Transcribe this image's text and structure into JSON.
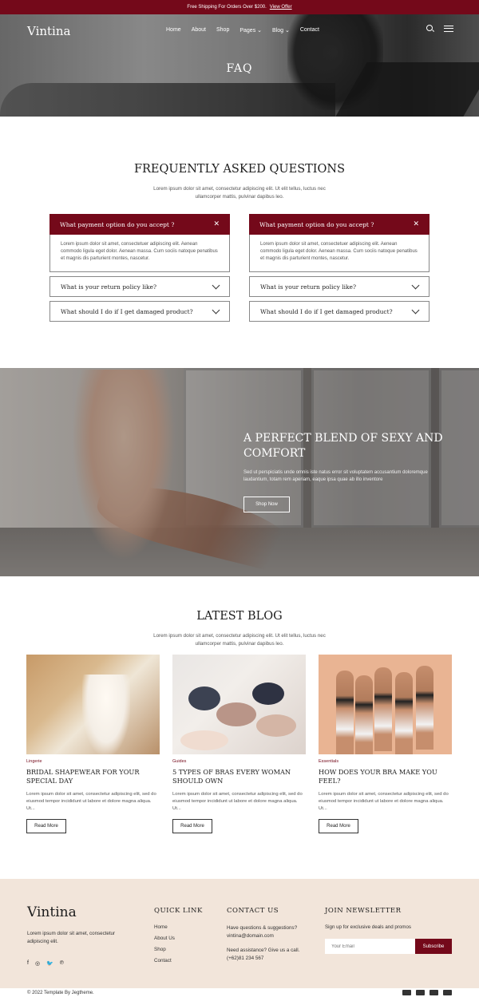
{
  "topbar": {
    "text": "Free Shipping For Orders Over $200.",
    "offer": "View Offer"
  },
  "header": {
    "logo": "Vintina",
    "nav": [
      "Home",
      "About",
      "Shop",
      "Pages",
      "Blog",
      "Contact"
    ],
    "hero_title": "FAQ"
  },
  "faq": {
    "title": "FREQUENTLY ASKED QUESTIONS",
    "subtitle": "Lorem ipsum dolor sit amet, consectetur adipiscing elit. Ut elit tellus, luctus nec ullamcorper mattis, pulvinar dapibus leo.",
    "columns": [
      {
        "open_question": "What payment option do you accept ?",
        "open_answer": "Lorem ipsum dolor sit amet, consectetuer adipiscing elit. Aenean commodo ligula eget dolor. Aenean massa. Cum sociis natoque penatibus et magnis dis parturient montes, nascetur.",
        "questions": [
          "What is your return policy like?",
          "What should I do if I get damaged product?"
        ]
      },
      {
        "open_question": "What payment option do you accept ?",
        "open_answer": "Lorem ipsum dolor sit amet, consectetuer adipiscing elit. Aenean commodo ligula eget dolor. Aenean massa. Cum sociis natoque penatibus et magnis dis parturient montes, nascetur.",
        "questions": [
          "What is your return policy like?",
          "What should I do if I get damaged product?"
        ]
      }
    ]
  },
  "banner": {
    "title": "A PERFECT BLEND OF SEXY AND COMFORT",
    "text": "Sed ut perspiciatis unde omnis iste natus error sit voluptatem accusantium doloremque laudantium, totam rem aperiam, eaque ipsa quae ab illo inventore",
    "button": "Shop Now"
  },
  "blog": {
    "title": "LATEST BLOG",
    "subtitle": "Lorem ipsum dolor sit amet, consectetur adipiscing elit. Ut elit tellus, luctus nec ullamcorper mattis, pulvinar dapibus leo.",
    "posts": [
      {
        "category": "Lingerie",
        "title": "BRIDAL SHAPEWEAR FOR YOUR SPECIAL DAY",
        "excerpt": "Lorem ipsum dolor sit amet, consectetur adipiscing elit, sed do eiusmod tempor incididunt ut labore et dolore magna aliqua. Ut...",
        "button": "Read More"
      },
      {
        "category": "Guides",
        "title": "5 TYPES OF BRAS EVERY WOMAN SHOULD OWN",
        "excerpt": "Lorem ipsum dolor sit amet, consectetur adipiscing elit, sed do eiusmod tempor incididunt ut labore et dolore magna aliqua. Ut...",
        "button": "Read More"
      },
      {
        "category": "Essentials",
        "title": "HOW DOES YOUR BRA MAKE YOU FEEL?",
        "excerpt": "Lorem ipsum dolor sit amet, consectetur adipiscing elit, sed do eiusmod tempor incididunt ut labore et dolore magna aliqua. Ut...",
        "button": "Read More"
      }
    ]
  },
  "footer": {
    "logo": "Vintina",
    "about": "Lorem ipsum dolor sit amet, consectetur adipiscing elit.",
    "socials": [
      "f",
      "◎",
      "🐦",
      "℗"
    ],
    "quick_link_title": "QUICK LINK",
    "quick_links": [
      "Home",
      "About Us",
      "Shop",
      "Contact"
    ],
    "contact_title": "CONTACT US",
    "contact_q1": "Have questions & suggestions?",
    "contact_email": "vintina@domain.com",
    "contact_q2": "Need assistance? Give us a call.",
    "contact_phone": "(+62)81 234 567",
    "newsletter_title": "JOIN NEWSLETTER",
    "newsletter_text": "Sign up for exclusive deals and promos",
    "newsletter_placeholder": "Your Email",
    "newsletter_button": "Subscribe",
    "copyright": "© 2022 Template By Jegtheme."
  },
  "colors": {
    "brand": "#74091a",
    "footer_bg": "#f2e5da"
  }
}
